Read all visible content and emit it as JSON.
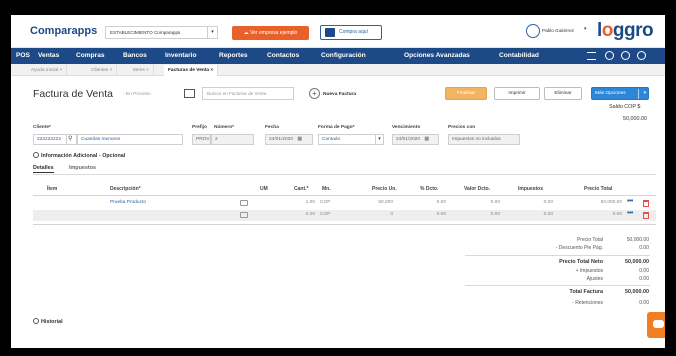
{
  "topbar": {
    "brand": "Comparapps",
    "establecimiento": "ESTABLECIMIENTO Comparapps",
    "ver_ejemplo": "Ver empresa ejemplo",
    "compra_aqui": "Compra aquí",
    "user_name": "Pablo Gutiérrez",
    "logo_first": "l",
    "logo_o": "o",
    "logo_rest": "ggro"
  },
  "nav": {
    "items": [
      "POS",
      "Ventas",
      "Compras",
      "Bancos",
      "Inventario",
      "Reportes",
      "Contactos",
      "Configuración",
      "Opciones Avanzadas",
      "Contabilidad"
    ]
  },
  "tabs": [
    "Ayuda Inicial ×",
    "Clientes ×",
    "Items ×",
    "Facturas de Venta ×"
  ],
  "header": {
    "title": "Factura de Venta",
    "process": "- En Proceso",
    "search_placeholder": "Buscar en Facturas de Venta",
    "nueva_factura": "Nueva Factura",
    "finalizar": "Finalizar",
    "imprimir": "Imprimir",
    "eliminar": "Eliminar",
    "mas_opciones": "Más Opciones",
    "saldo_label": "Saldo COP $",
    "saldo_value": "50,000.00"
  },
  "form": {
    "cliente_label": "Cliente*",
    "cliente_code": "222222222",
    "cliente_name": "Cuantías menores",
    "prefijo_label": "Prefijo",
    "numero_label": "Número*",
    "prefijo": "PROV",
    "numero": "2",
    "fecha_label": "Fecha",
    "fecha": "24/01/2020",
    "forma_label": "Forma de Pago*",
    "forma": "Contado",
    "vencimiento_label": "Vencimiento",
    "vencimiento": "24/01/2020",
    "precios_label": "Precios con",
    "precios": "Impuestos no incluidos",
    "info_adicional": "Información Adicional - Opcional"
  },
  "subtabs": [
    "Detalles",
    "Impuestos"
  ],
  "table": {
    "headers": [
      "Ítem",
      "Descripción*",
      "UM",
      "Cant.*",
      "Mn.",
      "Precio Un.",
      "% Dcto.",
      "Valor Dcto.",
      "Impuestos",
      "Precio Total"
    ],
    "rows": [
      {
        "descripcion": "Prueba Producto",
        "cant": "1.00",
        "mn": "COP",
        "precio": "50,000",
        "dcto": "0.00",
        "valor_dcto": "0.00",
        "impuestos": "0.00",
        "total": "50,000.00"
      },
      {
        "descripcion": "",
        "cant": "0.00",
        "mn": "COP",
        "precio": "0",
        "dcto": "0.00",
        "valor_dcto": "0.00",
        "impuestos": "0.00",
        "total": "0.00"
      }
    ]
  },
  "totals": {
    "precio_total_label": "Precio Total",
    "precio_total": "50,000.00",
    "descuento_label": "- Descuento Pie Pág.",
    "descuento": "0.00",
    "precio_neto_label": "Precio Total Neto",
    "precio_neto": "50,000.00",
    "impuestos_label": "+ Impuestos",
    "impuestos": "0.00",
    "ajustes_label": "Ajustes",
    "ajustes": "0.00",
    "total_factura_label": "Total Factura",
    "total_factura": "50,000.00",
    "retenciones_label": "- Retenciones",
    "retenciones": "0.00"
  },
  "historial": "Historial",
  "colors": {
    "nav": "#1d4a86",
    "accent": "#e8612b",
    "primary_button": "#2d86d6",
    "finalizar": "#f2b463"
  }
}
